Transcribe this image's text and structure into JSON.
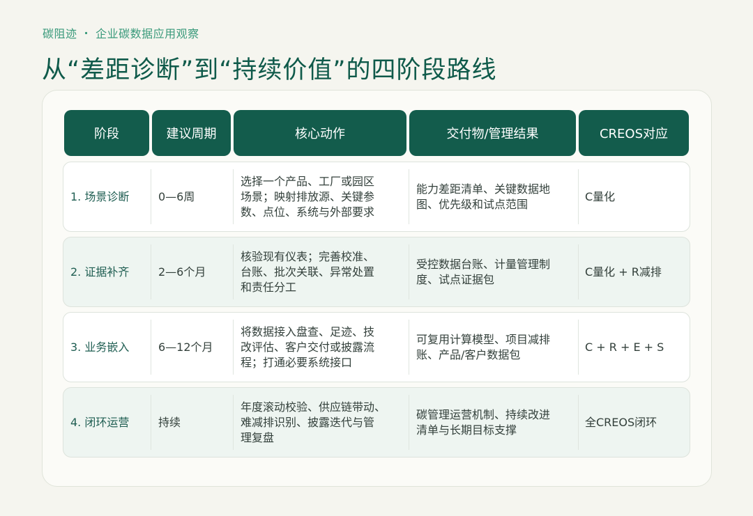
{
  "brand": {
    "name": "碳阻迹",
    "separator": "·",
    "section": "企业碳数据应用观察"
  },
  "title": "从“差距诊断”到“持续价值”的四阶段路线",
  "headers": [
    "阶段",
    "建议周期",
    "核心动作",
    "交付物/管理结果",
    "CREOS对应"
  ],
  "rows": [
    {
      "stage": "1. 场景诊断",
      "period": "0—6周",
      "actions": [
        "选择一个产品、工厂或园区",
        "场景；映射排放源、关键参",
        "数、点位、系统与外部要求"
      ],
      "deliverables": [
        "能力差距清单、关键数据地",
        "图、优先级和试点范围"
      ],
      "creos": "C量化"
    },
    {
      "stage": "2. 证据补齐",
      "period": "2—6个月",
      "actions": [
        "核验现有仪表；完善校准、",
        "台账、批次关联、异常处置",
        "和责任分工"
      ],
      "deliverables": [
        "受控数据台账、计量管理制",
        "度、试点证据包"
      ],
      "creos": "C量化 + R减排"
    },
    {
      "stage": "3. 业务嵌入",
      "period": "6—12个月",
      "actions": [
        "将数据接入盘查、足迹、技",
        "改评估、客户交付或披露流",
        "程；打通必要系统接口"
      ],
      "deliverables": [
        "可复用计算模型、项目减排",
        "账、产品/客户数据包"
      ],
      "creos": "C + R + E + S"
    },
    {
      "stage": "4. 闭环运营",
      "period": "持续",
      "actions": [
        "年度滚动校验、供应链带动、",
        "难减排识别、披露迭代与管",
        "理复盘"
      ],
      "deliverables": [
        "碳管理运营机制、持续改进",
        "清单与长期目标支撑"
      ],
      "creos": "全CREOS闭环"
    }
  ]
}
